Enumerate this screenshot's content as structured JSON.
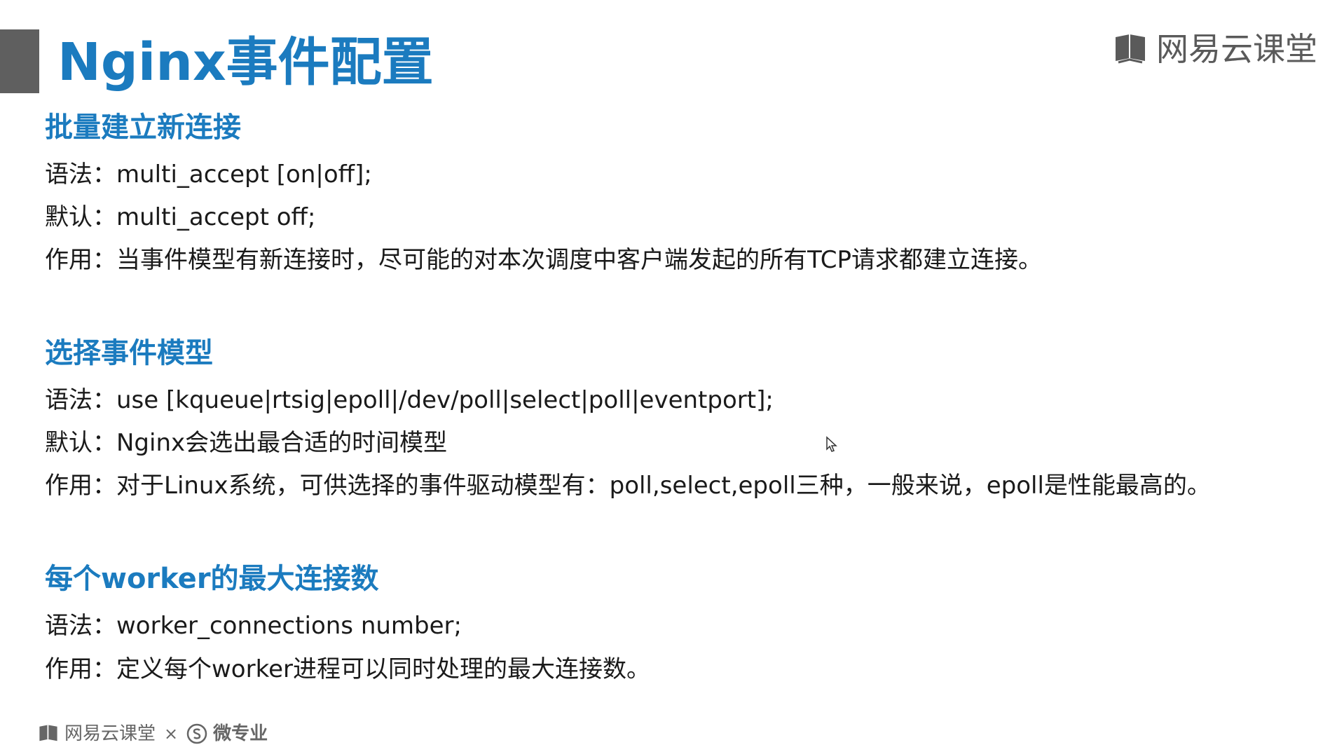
{
  "header": {
    "title": "Nginx事件配置",
    "brand": "网易云课堂"
  },
  "sections": [
    {
      "heading": "批量建立新连接",
      "lines": [
        "语法：multi_accept [on|off];",
        " 默认：multi_accept off;",
        "作用：当事件模型有新连接时，尽可能的对本次调度中客户端发起的所有TCP请求都建立连接。"
      ]
    },
    {
      "heading": "选择事件模型",
      "lines": [
        "语法：use [kqueue|rtsig|epoll|/dev/poll|select|poll|eventport];",
        "默认：Nginx会选出最合适的时间模型",
        "作用：对于Linux系统，可供选择的事件驱动模型有：poll,select,epoll三种，一般来说，epoll是性能最高的。"
      ]
    },
    {
      "heading": "每个worker的最大连接数",
      "lines": [
        "语法：worker_connections number;",
        "作用：定义每个worker进程可以同时处理的最大连接数。"
      ]
    }
  ],
  "footer": {
    "brand": "网易云课堂",
    "separator": "×",
    "partner": "微专业"
  },
  "icons": {
    "brand": "book-icon",
    "partner": "s-circle-icon",
    "cursor": "mouse-pointer-icon"
  },
  "colors": {
    "accent": "#1b7bbf",
    "title_bar": "#5f5f5f",
    "text": "#1a1a1a",
    "brand": "#5a5a5a"
  }
}
